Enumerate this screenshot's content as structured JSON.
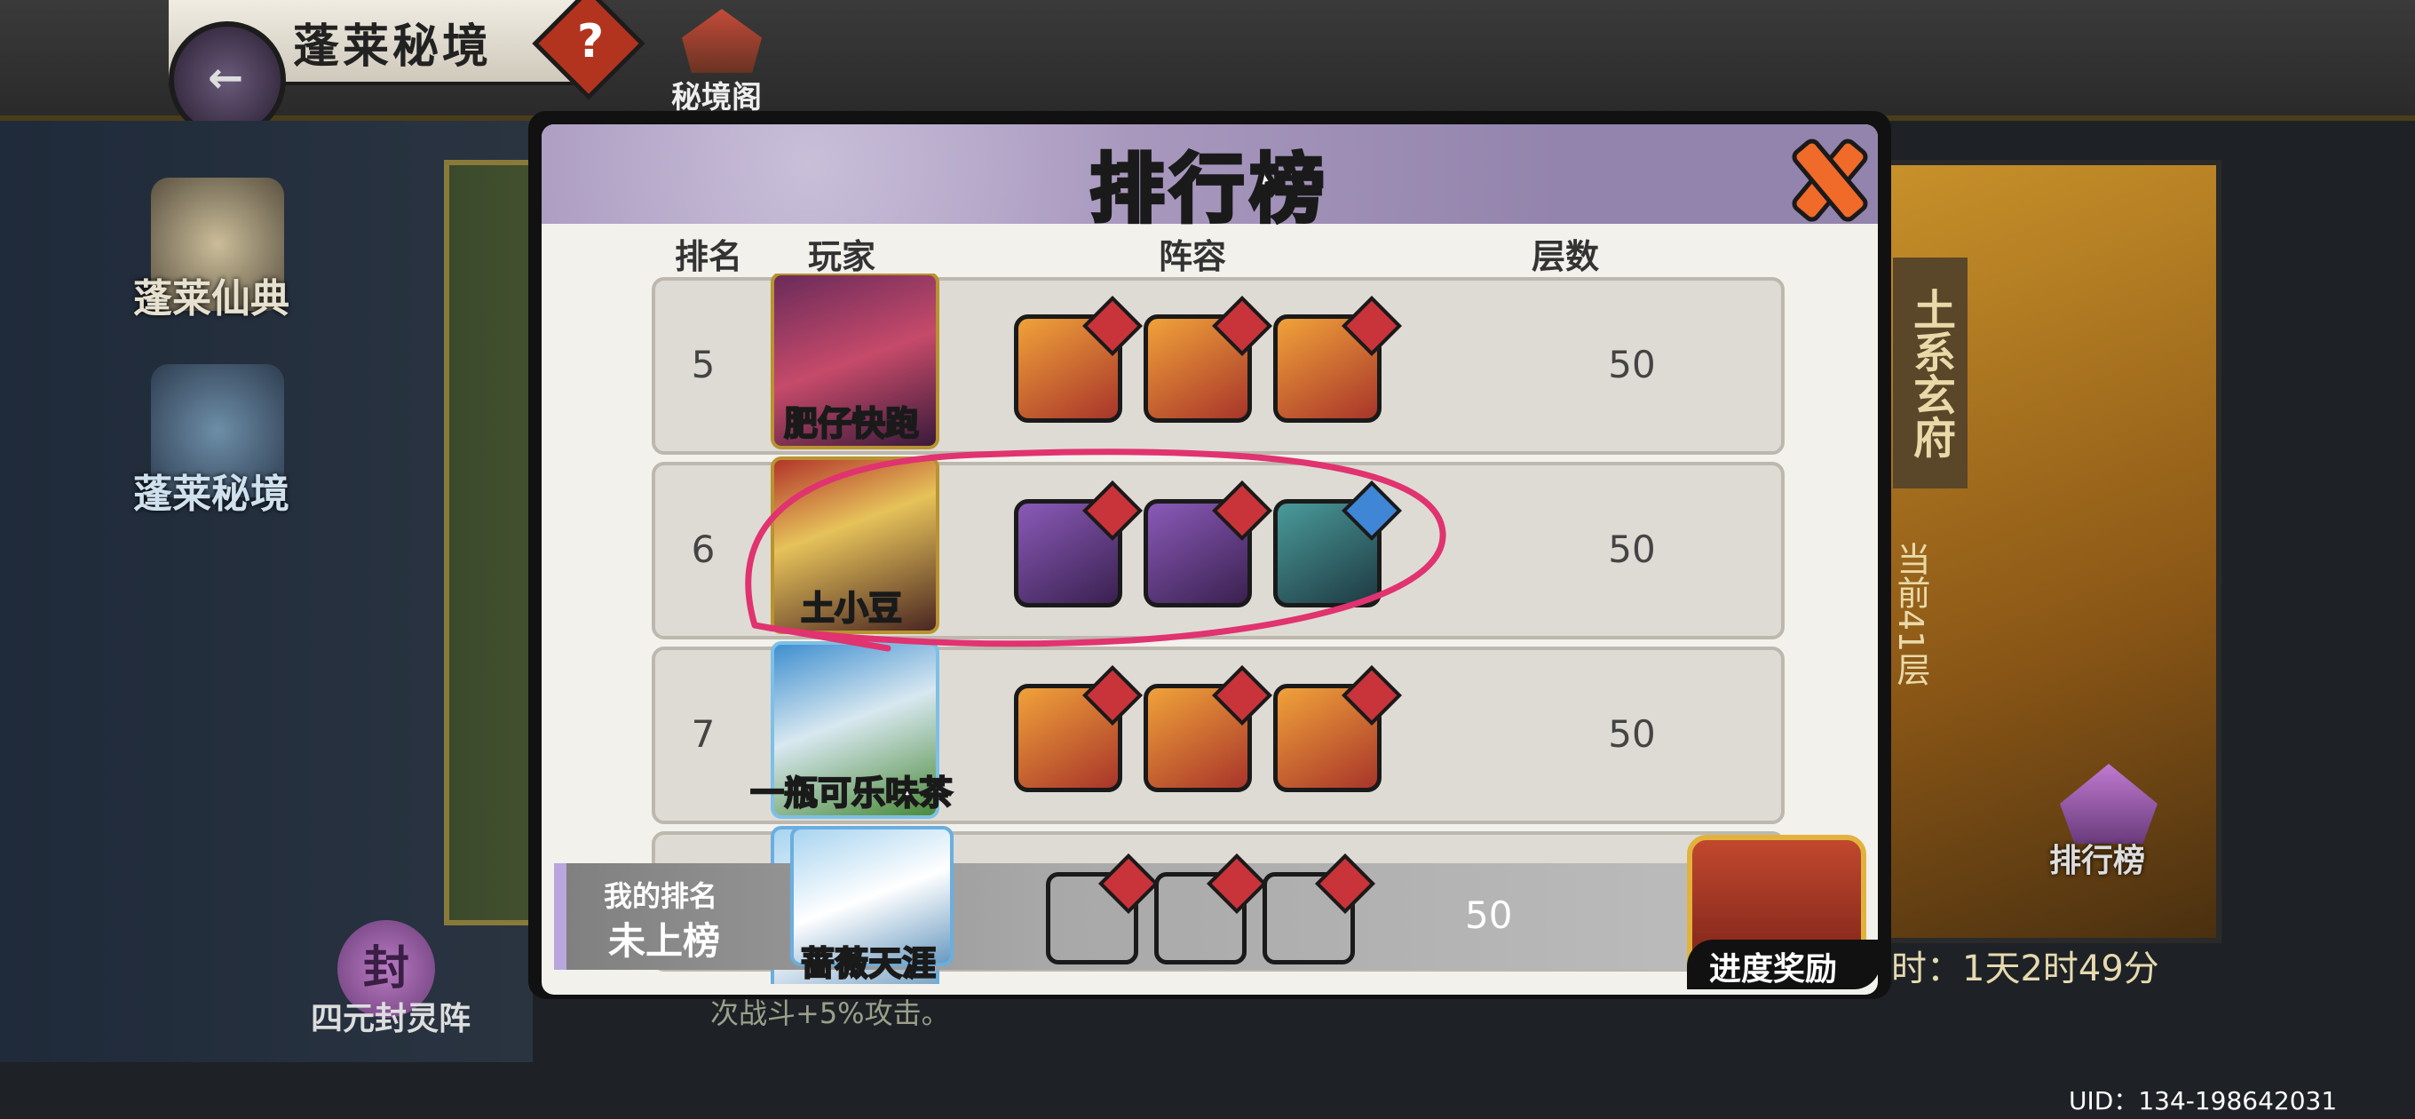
{
  "header": {
    "title": "蓬莱秘境",
    "help_glyph": "?",
    "secret_pavilion_label": "秘境阁"
  },
  "sidebar": {
    "items": [
      {
        "label": "蓬莱仙典"
      },
      {
        "label": "蓬莱秘境"
      }
    ],
    "seal_array_glyph": "封",
    "seal_array_label": "四元封灵阵"
  },
  "background": {
    "hint_fragment": "次战斗+5%攻击。",
    "right_title": "土系玄府",
    "current_floor": "当前41层",
    "leaderboard_label": "排行榜",
    "countdown": "时：1天2时49分",
    "uid": "UID：134-198642031"
  },
  "modal": {
    "title": "排行榜",
    "columns": {
      "rank": "排名",
      "player": "玩家",
      "lineup": "阵容",
      "floors": "层数"
    },
    "rows": [
      {
        "rank": "5",
        "name": "肥仔快跑",
        "floors": "50"
      },
      {
        "rank": "6",
        "name": "土小豆",
        "floors": "50"
      },
      {
        "rank": "7",
        "name": "一瓶可乐味茶",
        "floors": "50"
      }
    ],
    "my_rank": {
      "label": "我的排名",
      "value": "未上榜",
      "name": "蔷薇天涯",
      "floors": "50"
    },
    "progress_reward_label": "进度奖励"
  },
  "colors": {
    "header_purple": "#9384ad",
    "annotation_pink": "#e0336f",
    "row_bg": "#dedbd5"
  }
}
